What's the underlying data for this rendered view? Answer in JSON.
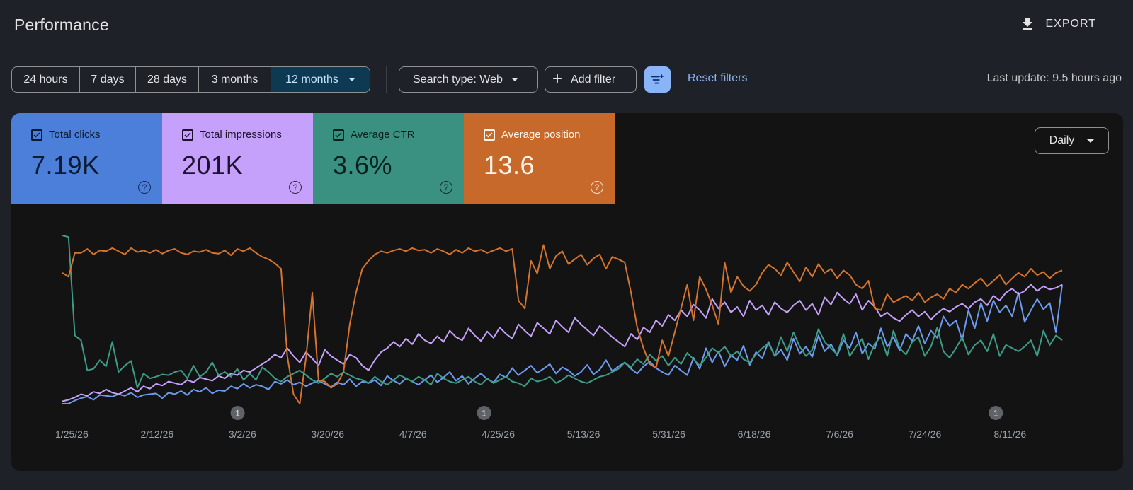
{
  "header": {
    "title": "Performance",
    "export_label": "EXPORT"
  },
  "filters": {
    "ranges": [
      "24 hours",
      "7 days",
      "28 days",
      "3 months",
      "12 months"
    ],
    "selected_range": "12 months",
    "search_type": "Search type: Web",
    "add_filter": "Add filter",
    "reset": "Reset filters",
    "last_update": "Last update: 9.5 hours ago"
  },
  "metrics": [
    {
      "label": "Total clicks",
      "value": "7.19K",
      "color": "#4b7fd9"
    },
    {
      "label": "Total impressions",
      "value": "201K",
      "color": "#c6a1fb"
    },
    {
      "label": "Average CTR",
      "value": "3.6%",
      "color": "#3a9181"
    },
    {
      "label": "Average position",
      "value": "13.6",
      "color": "#c6692b"
    }
  ],
  "granularity": "Daily",
  "chart_data": {
    "type": "line",
    "x_tick_labels": [
      "1/25/26",
      "2/12/26",
      "3/2/26",
      "3/20/26",
      "4/7/26",
      "4/25/26",
      "5/13/26",
      "5/31/26",
      "6/18/26",
      "7/6/26",
      "7/24/26",
      "8/11/26"
    ],
    "x_range": [
      "1/23/26",
      "8/22/26"
    ],
    "annotations": [
      {
        "date": "3/1/26",
        "label": "1"
      },
      {
        "date": "4/22/26",
        "label": "1"
      },
      {
        "date": "8/8/26",
        "label": "1"
      }
    ],
    "grid": false,
    "legend": "metric cards above chart",
    "series": [
      {
        "name": "Total clicks",
        "color": "#6d9bf0",
        "values": [
          0,
          0.2,
          4,
          7,
          9,
          5,
          11,
          10,
          9,
          12,
          10,
          14,
          8,
          11,
          12,
          13,
          7,
          14,
          12,
          16,
          11,
          18,
          15,
          20,
          13,
          17,
          16,
          22,
          19,
          25,
          20,
          24,
          22,
          18,
          28,
          25,
          30,
          24,
          27,
          22,
          26,
          29,
          25,
          21,
          27,
          24,
          31,
          22,
          28,
          26,
          30,
          23,
          35,
          29,
          25,
          32,
          28,
          24,
          30,
          36,
          27,
          33,
          40,
          29,
          35,
          25,
          32,
          38,
          31,
          27,
          37,
          33,
          45,
          36,
          42,
          48,
          39,
          44,
          50,
          38,
          46,
          42,
          35,
          40,
          49,
          37,
          43,
          55,
          41,
          47,
          52,
          44,
          38,
          47,
          53,
          45,
          40,
          36,
          48,
          42,
          36,
          58,
          44,
          70,
          52,
          66,
          47,
          61,
          55,
          73,
          49,
          65,
          57,
          78,
          60,
          68,
          55,
          82,
          63,
          72,
          59,
          86,
          66,
          75,
          61,
          80,
          70,
          90,
          63,
          76,
          69,
          95,
          72,
          84,
          67,
          88,
          79,
          98,
          76,
          92,
          83,
          110,
          98,
          105,
          80,
          118,
          95,
          127,
          104,
          130,
          115,
          124,
          110,
          140,
          103,
          118,
          132,
          119,
          127,
          90,
          150
        ]
      },
      {
        "name": "Total impressions",
        "color": "#c6a1fb",
        "values": [
          3,
          5,
          8,
          12,
          10,
          15,
          13,
          18,
          14,
          12,
          16,
          20,
          15,
          22,
          19,
          25,
          23,
          28,
          26,
          24,
          30,
          27,
          33,
          31,
          29,
          35,
          32,
          38,
          36,
          42,
          40,
          45,
          50,
          55,
          62,
          58,
          70,
          60,
          52,
          65,
          57,
          48,
          68,
          60,
          55,
          50,
          62,
          58,
          48,
          42,
          55,
          65,
          70,
          78,
          72,
          82,
          75,
          88,
          80,
          76,
          85,
          78,
          92,
          84,
          80,
          95,
          86,
          79,
          91,
          83,
          96,
          88,
          82,
          100,
          92,
          85,
          102,
          95,
          88,
          105,
          97,
          90,
          108,
          100,
          93,
          86,
          98,
          91,
          84,
          78,
          72,
          88,
          81,
          96,
          90,
          105,
          98,
          112,
          105,
          118,
          110,
          125,
          118,
          108,
          132,
          120,
          128,
          115,
          122,
          110,
          130,
          118,
          124,
          112,
          128,
          120,
          115,
          124,
          130,
          118,
          126,
          112,
          134,
          125,
          140,
          132,
          126,
          138,
          118,
          130,
          122,
          110,
          115,
          108,
          104,
          112,
          118,
          110,
          116,
          106,
          114,
          120,
          116,
          122,
          126,
          120,
          128,
          132,
          124,
          136,
          130,
          140,
          145,
          138,
          142,
          150,
          142,
          148,
          144,
          146,
          150
        ]
      },
      {
        "name": "Average CTR",
        "color": "#3e9c86",
        "values": [
          212,
          210,
          86,
          80,
          42,
          44,
          55,
          47,
          78,
          40,
          48,
          54,
          20,
          38,
          32,
          34,
          37,
          36,
          40,
          42,
          32,
          48,
          34,
          40,
          52,
          36,
          40,
          34,
          44,
          30,
          38,
          30,
          46,
          40,
          32,
          28,
          34,
          38,
          42,
          36,
          30,
          26,
          32,
          38,
          34,
          40,
          36,
          32,
          30,
          26,
          34,
          28,
          24,
          30,
          36,
          32,
          28,
          34,
          30,
          24,
          38,
          32,
          28,
          26,
          30,
          34,
          28,
          24,
          32,
          26,
          30,
          34,
          28,
          26,
          22,
          32,
          28,
          30,
          34,
          26,
          30,
          36,
          32,
          28,
          26,
          30,
          34,
          36,
          40,
          44,
          52,
          46,
          56,
          50,
          62,
          54,
          60,
          48,
          58,
          50,
          64,
          56,
          48,
          58,
          70,
          64,
          72,
          60,
          66,
          56,
          52,
          62,
          70,
          76,
          60,
          84,
          66,
          90,
          72,
          60,
          68,
          94,
          78,
          70,
          62,
          88,
          60,
          72,
          82,
          56,
          76,
          84,
          60,
          92,
          70,
          62,
          78,
          84,
          60,
          72,
          96,
          66,
          58,
          70,
          84,
          62,
          74,
          80,
          66,
          88,
          60,
          74,
          70,
          66,
          72,
          80,
          60,
          92,
          74,
          86,
          80
        ]
      },
      {
        "name": "Average position",
        "color": "#d4742f",
        "values": [
          165,
          160,
          190,
          190,
          195,
          188,
          193,
          192,
          196,
          192,
          188,
          196,
          191,
          193,
          190,
          194,
          189,
          193,
          195,
          190,
          188,
          192,
          191,
          194,
          190,
          189,
          193,
          187,
          195,
          192,
          196,
          190,
          185,
          182,
          177,
          170,
          60,
          12,
          0,
          58,
          140,
          30,
          28,
          20,
          25,
          40,
          100,
          140,
          170,
          180,
          188,
          192,
          190,
          193,
          195,
          192,
          196,
          193,
          194,
          190,
          195,
          192,
          188,
          194,
          190,
          196,
          192,
          194,
          190,
          193,
          196,
          192,
          195,
          130,
          120,
          180,
          164,
          200,
          170,
          186,
          192,
          176,
          182,
          188,
          175,
          183,
          188,
          170,
          185,
          182,
          178,
          140,
          96,
          70,
          50,
          45,
          80,
          60,
          90,
          120,
          150,
          105,
          160,
          144,
          124,
          100,
          178,
          140,
          160,
          148,
          142,
          150,
          165,
          175,
          170,
          162,
          178,
          166,
          154,
          172,
          160,
          176,
          165,
          170,
          158,
          168,
          162,
          150,
          145,
          155,
          120,
          118,
          138,
          128,
          132,
          136,
          130,
          140,
          128,
          134,
          138,
          132,
          145,
          140,
          150,
          145,
          152,
          158,
          148,
          155,
          162,
          150,
          158,
          165,
          160,
          170,
          162,
          166,
          158,
          165,
          168
        ]
      }
    ]
  }
}
